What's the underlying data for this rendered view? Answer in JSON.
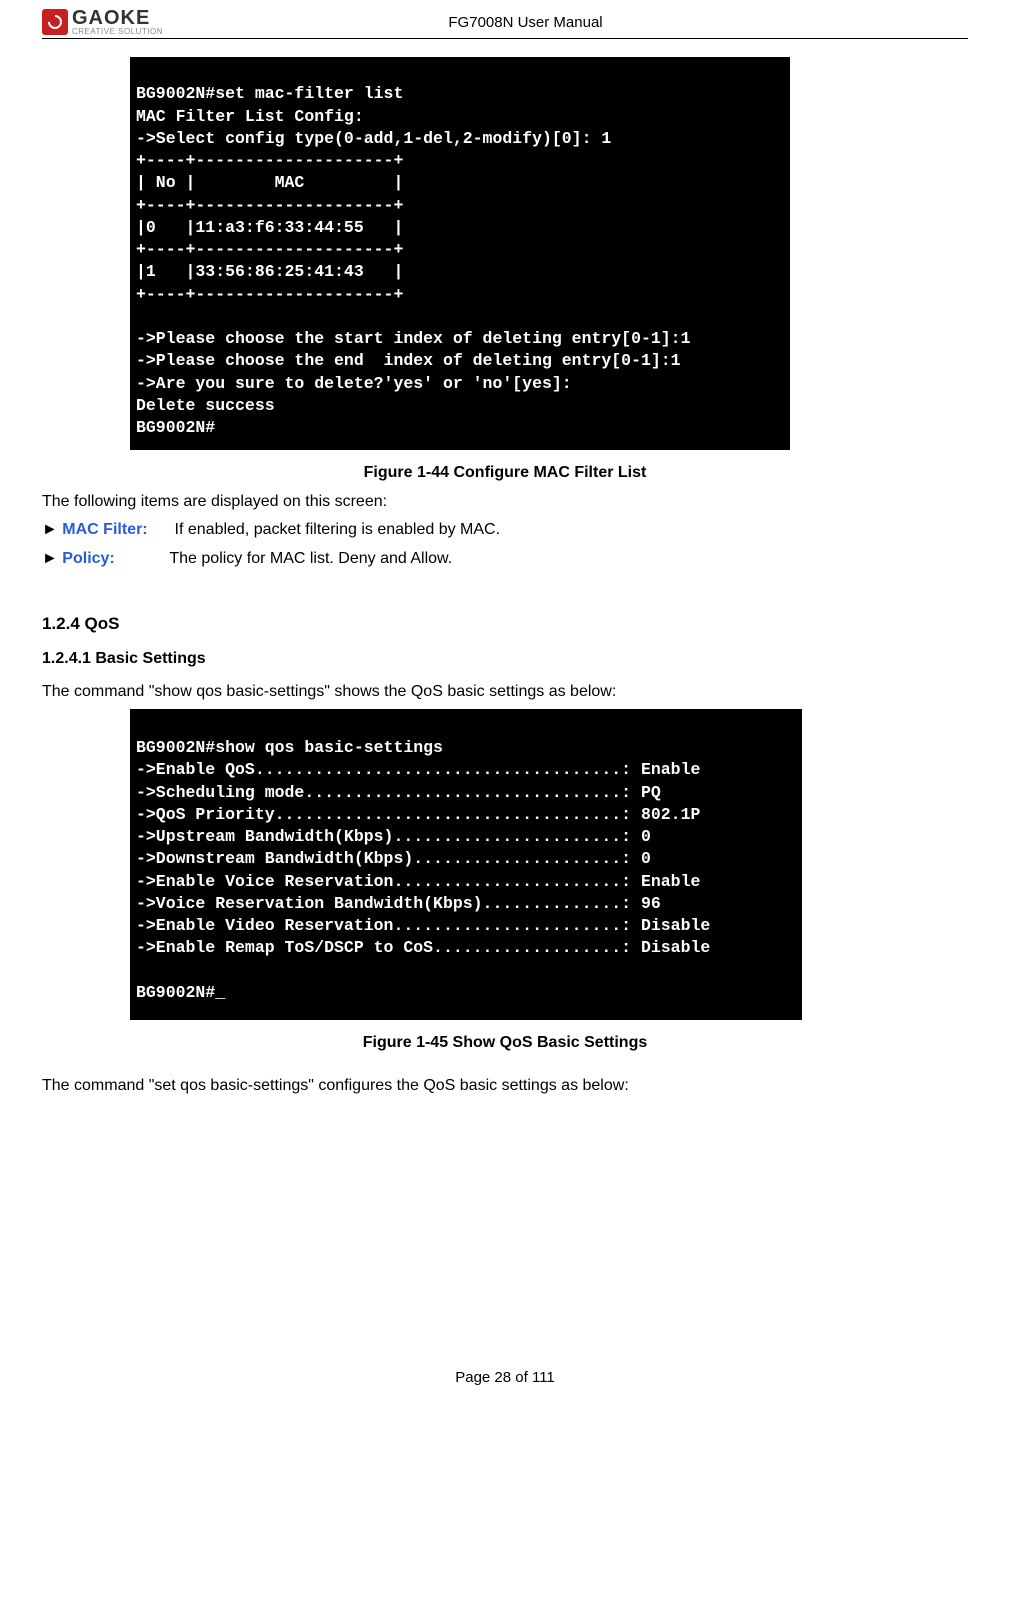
{
  "header": {
    "logo_main": "GAOKE",
    "logo_sub": "CREATIVE SOLUTION",
    "title": "FG7008N User Manual"
  },
  "terminal1": {
    "lines": [
      "BG9002N#set mac-filter list",
      "MAC Filter List Config:",
      "->Select config type(0-add,1-del,2-modify)[0]: 1",
      "+----+--------------------+",
      "| No |        MAC         |",
      "+----+--------------------+",
      "|0   |11:a3:f6:33:44:55   |",
      "+----+--------------------+",
      "|1   |33:56:86:25:41:43   |",
      "+----+--------------------+",
      "",
      "->Please choose the start index of deleting entry[0-1]:1",
      "->Please choose the end  index of deleting entry[0-1]:1",
      "->Are you sure to delete?'yes' or 'no'[yes]:",
      "Delete success",
      "BG9002N#"
    ]
  },
  "figure1_caption": "Figure 1-44   Configure MAC Filter List",
  "intro1": "The following items are displayed on this screen:",
  "bullets": [
    {
      "label": "MAC Filter:",
      "desc": "If enabled, packet filtering is enabled by MAC."
    },
    {
      "label": "Policy:",
      "desc": "The policy for MAC list. Deny and Allow."
    }
  ],
  "section_qos": "1.2.4    QoS",
  "subsection_basic": "1.2.4.1   Basic Settings",
  "intro2": "The command \"show qos basic-settings\" shows the QoS basic settings as below:",
  "terminal2": {
    "lines": [
      "BG9002N#show qos basic-settings",
      "->Enable QoS.....................................: Enable",
      "->Scheduling mode................................: PQ",
      "->QoS Priority...................................: 802.1P",
      "->Upstream Bandwidth(Kbps).......................: 0",
      "->Downstream Bandwidth(Kbps).....................: 0",
      "->Enable Voice Reservation.......................: Enable",
      "->Voice Reservation Bandwidth(Kbps)..............: 96",
      "->Enable Video Reservation.......................: Disable",
      "->Enable Remap ToS/DSCP to CoS...................: Disable",
      "",
      "BG9002N#_"
    ]
  },
  "figure2_caption": "Figure 1-45   Show QoS Basic Settings",
  "intro3": "The command \"set qos basic-settings\" configures the QoS basic settings as below:",
  "footer": "Page 28 of 111"
}
